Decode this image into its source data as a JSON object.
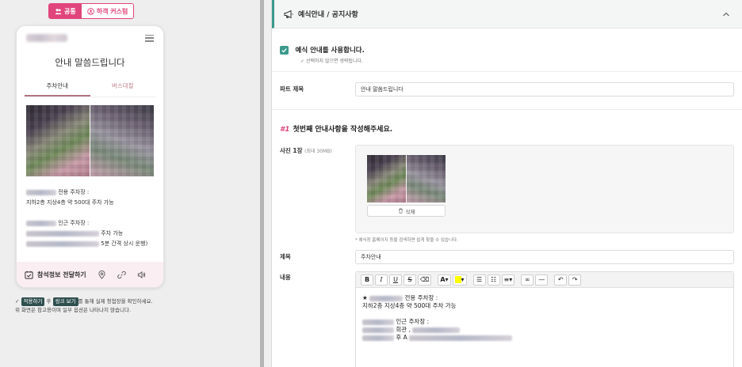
{
  "preview": {
    "toggle": {
      "common": "공통",
      "custom": "하객 커스텀"
    },
    "phone": {
      "title": "안내 말씀드립니다",
      "tabs": [
        "주차안내",
        "버스대절"
      ],
      "text_line1_suffix": "전용 주차장 :",
      "text_line2": "지하2층 지상4층 약 500대 주차 가능",
      "text_line3_suffix": "인근 주차장 :",
      "text_line4_suffix": "주차 가능",
      "text_line5_suffix": "5분 간격 상시 운행)",
      "share_label": "참석정보 전달하기"
    },
    "help": {
      "pill_apply": "적용하기",
      "connector": "후",
      "pill_link": "링크 보기",
      "line1_tail": "를 통해 실제 청첩장을 확인하세요.",
      "line2": "위 화면은 참고용이며 일부 옵션은 나타나지 않습니다."
    }
  },
  "form": {
    "section_title": "예식안내 / 공지사항",
    "use_checkbox": {
      "label": "예식 안내를 사용합니다.",
      "checked": true,
      "sub": "선택하지 않으면 생략됩니다."
    },
    "part_title": {
      "label": "파트 제목",
      "value": "안내 말씀드립니다"
    },
    "step": {
      "num": "#1",
      "text": "첫번째 안내사항을 작성해주세요."
    },
    "photo": {
      "label": "사진 1장",
      "limit": "(최대 30MB)",
      "delete": "삭제",
      "note": "* 예식장 홈페이지 등을 검색하면 쉽게 찾을 수 있습니다."
    },
    "subject": {
      "label": "제목",
      "value": "주차안내"
    },
    "content": {
      "label": "내용",
      "toolbar": [
        "B",
        "I",
        "U",
        "S",
        "A"
      ],
      "line1_prefix": "★",
      "line1_suffix": "전용 주차장 :",
      "line2": "지하2층 지상4층 약 500대 주차 가능",
      "line3_suffix": "인근 주차장 :",
      "line4_mid": "회관 ,",
      "line5_mid": "후 A"
    }
  }
}
